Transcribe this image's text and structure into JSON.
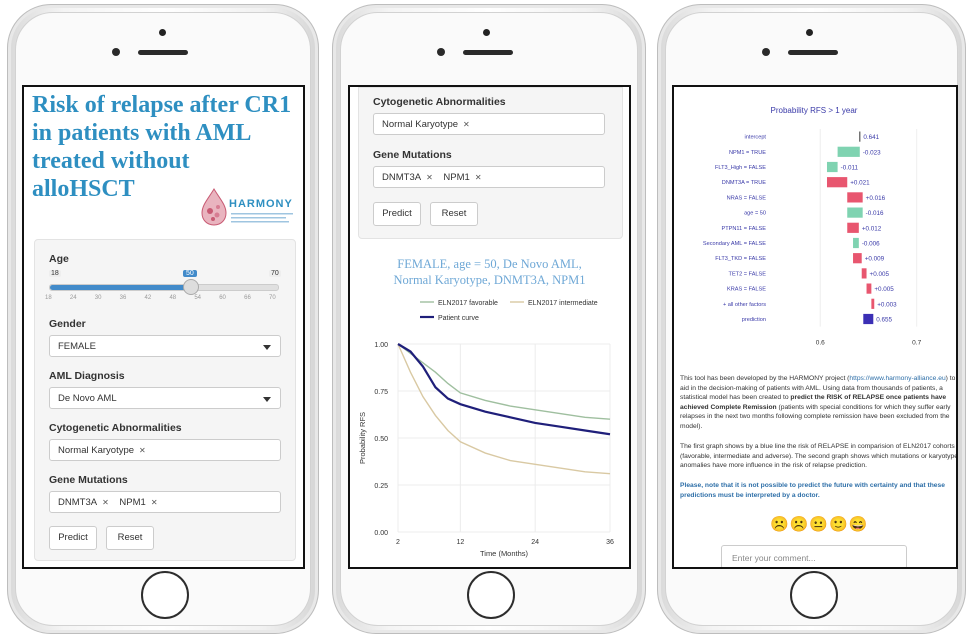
{
  "screen1": {
    "title": "Risk of relapse after CR1 in patients with AML treated without alloHSCT",
    "logo_text": "HARMONY",
    "age_label": "Age",
    "age_min": "18",
    "age_value": "50",
    "age_max": "70",
    "age_ticks": [
      "18",
      "24",
      "30",
      "36",
      "42",
      "48",
      "54",
      "60",
      "66",
      "70"
    ],
    "gender_label": "Gender",
    "gender_value": "FEMALE",
    "diagnosis_label": "AML Diagnosis",
    "diagnosis_value": "De Novo AML",
    "cyto_label": "Cytogenetic Abnormalities",
    "cyto_value": "Normal Karyotype",
    "gene_label": "Gene Mutations",
    "genes": [
      "DNMT3A",
      "NPM1"
    ],
    "predict_label": "Predict",
    "reset_label": "Reset"
  },
  "screen2": {
    "cyto_label": "Cytogenetic Abnormalities",
    "cyto_value": "Normal Karyotype",
    "gene_label": "Gene Mutations",
    "genes": [
      "DNMT3A",
      "NPM1"
    ],
    "predict_label": "Predict",
    "reset_label": "Reset",
    "chart_title_line1": "FEMALE, age = 50, De Novo AML,",
    "chart_title_line2": "Normal Karyotype, DNMT3A, NPM1",
    "colors": {
      "favorable": "#9fbf9f",
      "intermediate": "#d9c9a3",
      "patient": "#1f1f7a"
    }
  },
  "screen3": {
    "chart_title": "Probability RFS > 1 year",
    "description_p1_a": "This tool has been developed by the HARMONY project (",
    "description_link": "https://www.harmony-alliance.eu",
    "description_p1_b": ") to aid in the decision-making of patients with AML. Using data from thousands of patients, a statistical model has been created to ",
    "description_p1_bold": "predict the RISK of RELAPSE once patients have achieved Complete Remission",
    "description_p1_c": " (patients with special conditions for which they suffer early relapses in the next two months following complete remission have been excluded from the model).",
    "description_p2": "The first graph shows by a blue line the risk of RELAPSE in comparision of ELN2017 cohorts (favorable, intermediate and adverse). The second graph shows which mutations or karyotype anomalies have more influence in the risk of relapse prediction.",
    "note": "Please, note that it is not possible to predict the future with certainty and that these predictions must be interpreted by a doctor.",
    "emojis": "☹️☹️😐🙂😄",
    "comment_placeholder": "Enter your comment...",
    "colors": {
      "positive": "#e8566f",
      "negative": "#7fd3b1",
      "prediction": "#3b2fb5",
      "text": "#3a3aa8"
    }
  },
  "chart_data": [
    {
      "type": "line",
      "title": "FEMALE, age = 50, De Novo AML, Normal Karyotype, DNMT3A, NPM1",
      "xlabel": "Time (Months)",
      "ylabel": "Probability RFS",
      "xlim": [
        2,
        36
      ],
      "ylim": [
        0,
        1
      ],
      "xticks": [
        2,
        12,
        24,
        36
      ],
      "yticks": [
        "0.00",
        "0.25",
        "0.50",
        "0.75",
        "1.00"
      ],
      "legend_position": "top",
      "grid": true,
      "series": [
        {
          "name": "ELN2017 favorable",
          "x": [
            2,
            4,
            6,
            8,
            10,
            12,
            16,
            20,
            24,
            28,
            32,
            36
          ],
          "y": [
            1.0,
            0.95,
            0.9,
            0.85,
            0.79,
            0.74,
            0.7,
            0.67,
            0.65,
            0.63,
            0.61,
            0.6
          ]
        },
        {
          "name": "ELN2017 intermediate",
          "x": [
            2,
            4,
            6,
            8,
            10,
            12,
            16,
            20,
            24,
            28,
            32,
            36
          ],
          "y": [
            1.0,
            0.85,
            0.72,
            0.62,
            0.54,
            0.48,
            0.42,
            0.38,
            0.36,
            0.34,
            0.32,
            0.31
          ]
        },
        {
          "name": "Patient curve",
          "x": [
            2,
            4,
            6,
            8,
            10,
            12,
            16,
            20,
            24,
            28,
            32,
            36
          ],
          "y": [
            1.0,
            0.96,
            0.88,
            0.77,
            0.71,
            0.68,
            0.64,
            0.61,
            0.58,
            0.56,
            0.54,
            0.52
          ]
        }
      ]
    },
    {
      "type": "bar",
      "title": "Probability RFS > 1 year",
      "orientation": "horizontal-waterfall",
      "xlim": [
        0.55,
        0.72
      ],
      "xticks": [
        "0.6",
        "0.7"
      ],
      "categories": [
        "intercept",
        "NPM1 = TRUE",
        "FLT3_High = FALSE",
        "DNMT3A = TRUE",
        "NRAS = FALSE",
        "age = 50",
        "PTPN11 = FALSE",
        "Secondary AML = FALSE",
        "FLT3_TKD = FALSE",
        "TET2 = FALSE",
        "KRAS = FALSE",
        "+ all other factors",
        "prediction"
      ],
      "labels": [
        "0.641",
        "-0.023",
        "-0.011",
        "+0.021",
        "+0.016",
        "-0.016",
        "+0.012",
        "-0.006",
        "+0.009",
        "+0.005",
        "+0.005",
        "+0.003",
        "0.655"
      ],
      "values": [
        0.641,
        -0.023,
        -0.011,
        0.021,
        0.016,
        -0.016,
        0.012,
        -0.006,
        0.009,
        0.005,
        0.005,
        0.003,
        0.655
      ]
    }
  ]
}
